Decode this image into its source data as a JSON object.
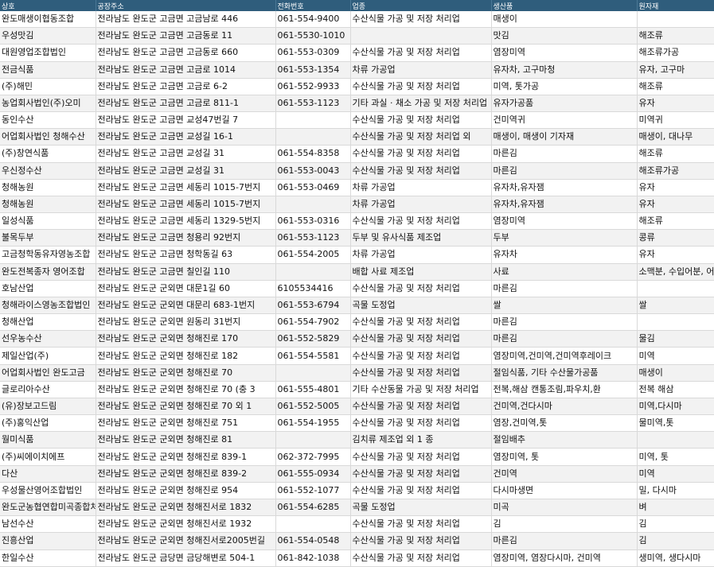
{
  "header": {
    "columns": [
      "상호",
      "공장주소",
      "전화번호",
      "업종",
      "생산품",
      "원자재"
    ]
  },
  "rows": [
    [
      "완도매생이협동조합",
      "전라남도 완도군 고금면 고금남로 446",
      "061-554-9400",
      "수산식물 가공 및 저장 처리업",
      "매생이",
      ""
    ],
    [
      "우성맛김",
      "전라남도 완도군 고금면 고금동로 11",
      "061-5530-1010",
      "",
      "맛김",
      "해조류"
    ],
    [
      "대원영업조합법인",
      "전라남도 완도군 고금면 고금동로 660",
      "061-553-0309",
      "수산식물 가공 및 저장 처리업",
      "염장미역",
      "해조류가공"
    ],
    [
      "전금식품",
      "전라남도 완도군 고금면 고금로 1014",
      "061-553-1354",
      "차류 가공업",
      "유자차, 고구마청",
      "유자, 고구마"
    ],
    [
      "(주)해민",
      "전라남도 완도군 고금면 고금로 6-2",
      "061-552-9933",
      "수산식물 가공 및 저장 처리업",
      "미역, 톳가공",
      "해조류"
    ],
    [
      "농업회사법인(주)오미",
      "전라남도 완도군 고금면 고금로 811-1",
      "061-553-1123",
      "기타 과실 · 채소 가공 및 저장 처리업",
      "유자가공품",
      "유자"
    ],
    [
      "동인수산",
      "전라남도 완도군 고금면 교성47번길 7",
      "",
      "수산식물 가공 및 저장 처리업",
      "건미역귀",
      "미역귀"
    ],
    [
      "어업회사법인 청해수산",
      "전라남도 완도군 고금면 교성길 16-1",
      "",
      "수산식물 가공 및 저장 처리업 외",
      "매생이, 매생이 기자재",
      "매생이, 대나무"
    ],
    [
      "(주)창연식품",
      "전라남도 완도군 고금면 교성길 31",
      "061-554-8358",
      "수산식물 가공 및 저장 처리업",
      "마른김",
      "해조류"
    ],
    [
      "우신정수산",
      "전라남도 완도군 고금면 교성길 31",
      "061-553-0043",
      "수산식물 가공 및 저장 처리업",
      "마른김",
      "해조류가공"
    ],
    [
      "청해농원",
      "전라남도 완도군 고금면 세동리 1015-7번지",
      "061-553-0469",
      "차류 가공업",
      "유자차,유자잼",
      "유자"
    ],
    [
      "청해농원",
      "전라남도 완도군 고금면 세동리 1015-7번지",
      "",
      "차류 가공업",
      "유자차,유자잼",
      "유자"
    ],
    [
      "일성식품",
      "전라남도 완도군 고금면 세동리 1329-5번지",
      "061-553-0316",
      "수산식물 가공 및 저장 처리업",
      "염장미역",
      "해조류"
    ],
    [
      "불목두부",
      "전라남도 완도군 고금면 청용리 92번지",
      "061-553-1123",
      "두부 및 유사식품 제조업",
      "두부",
      "콩류"
    ],
    [
      "고금청학동유자영농조합",
      "전라남도 완도군 고금면 청학동길 63",
      "061-554-2005",
      "차류 가공업",
      "유자차",
      "유자"
    ],
    [
      "완도전복종자 영어조합",
      "전라남도 완도군 고금면 칠인길 110",
      "",
      "배합 사료 제조업",
      "사료",
      "소맥분, 수입어분, 어유"
    ],
    [
      "호남산업",
      "전라남도 완도군 군외면 대문1길 60",
      "6105534416",
      "수산식물 가공 및 저장 처리업",
      "마른김",
      ""
    ],
    [
      "청해라이스영농조합법인",
      "전라남도 완도군 군외면 대문리 683-1번지",
      "061-553-6794",
      "곡물 도정업",
      "쌀",
      "쌀"
    ],
    [
      "청해산업",
      "전라남도 완도군 군외면 원동리 31번지",
      "061-554-7902",
      "수산식물 가공 및 저장 처리업",
      "마른김",
      ""
    ],
    [
      "선우농수산",
      "전라남도 완도군 군외면 청해진로 170",
      "061-552-5829",
      "수산식물 가공 및 저장 처리업",
      "마른김",
      "물김"
    ],
    [
      "제일산업(주)",
      "전라남도 완도군 군외면 청해진로 182",
      "061-554-5581",
      "수산식물 가공 및 저장 처리업",
      "염장미역,건미역,건미역후레이크",
      "미역"
    ],
    [
      "어업회사법인 완도고금",
      "전라남도 완도군 군외면 청해진로 70",
      "",
      "수산식물 가공 및 저장 처리업",
      "절임식품, 기타 수산물가공품",
      "매생이"
    ],
    [
      "글로리아수산",
      "전라남도 완도군 군외면 청해진로 70 (충 3",
      "061-555-4801",
      "기타 수산동물 가공 및 저장 처리업",
      "전복,해삼 캔통조림,파우치,환",
      "전복 해삼"
    ],
    [
      "(유)장보고드림",
      "전라남도 완도군 군외면 청해진로 70 외 1",
      "061-552-5005",
      "수산식물 가공 및 저장 처리업",
      "건미역,건다시마",
      "미역,다시마"
    ],
    [
      "(주)홍익산업",
      "전라남도 완도군 군외면 청해진로 751",
      "061-554-1955",
      "수산식물 가공 및 저장 처리업",
      "염장,건미역,톳",
      "물미역,톳"
    ],
    [
      "월미식품",
      "전라남도 완도군 군외면 청해진로 81",
      "",
      "김치류 제조업 외 1 종",
      "절임배추",
      ""
    ],
    [
      "(주)씨에이치에프",
      "전라남도 완도군 군외면 청해진로 839-1",
      "062-372-7995",
      "수산식물 가공 및 저장 처리업",
      "염장미역, 톳",
      "미역, 톳"
    ],
    [
      "다산",
      "전라남도 완도군 군외면 청해진로 839-2",
      "061-555-0934",
      "수산식물 가공 및 저장 처리업",
      "건미역",
      "미역"
    ],
    [
      "우성물산영어조합법인",
      "전라남도 완도군 군외면 청해진로 954",
      "061-552-1077",
      "수산식물 가공 및 저장 처리업",
      "다시마생면",
      "밀, 다시마"
    ],
    [
      "완도군농협연합미곡종합처리장",
      "전라남도 완도군 군외면 청해진서로 1832",
      "061-554-6285",
      "곡물 도정업",
      "미곡",
      "벼"
    ],
    [
      "남선수산",
      "전라남도 완도군 군외면 청해진서로 1932",
      "",
      "수산식물 가공 및 저장 처리업",
      "김",
      "김"
    ],
    [
      "진흥산업",
      "전라남도 완도군 군외면 청해진서로2005번길",
      "061-554-0548",
      "수산식물 가공 및 저장 처리업",
      "마른김",
      "김"
    ],
    [
      "한일수산",
      "전라남도 완도군 금당면 금당해변로 504-1",
      "061-842-1038",
      "수산식물 가공 및 저장 처리업",
      "염장미역, 염장다시마, 건미역",
      "생미역, 생다시마"
    ]
  ]
}
